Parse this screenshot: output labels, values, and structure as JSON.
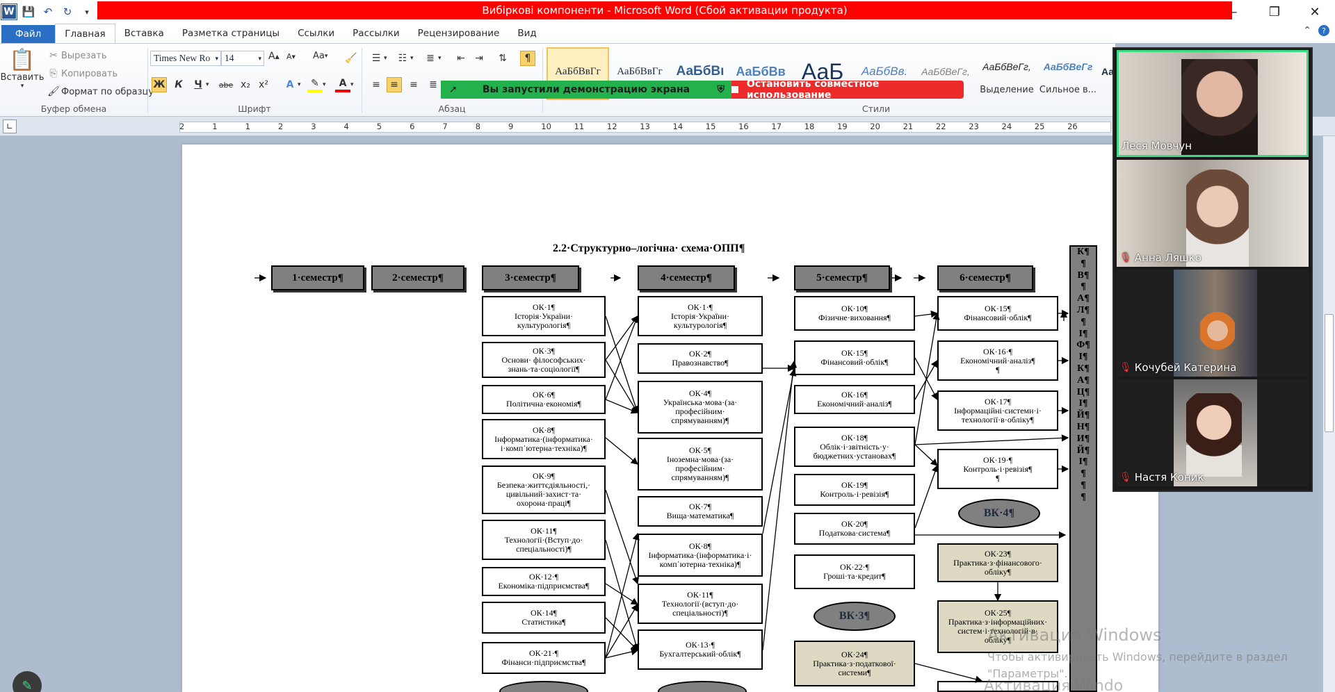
{
  "window": {
    "title": "Вибіркові компоненти - Microsoft Word (Сбой активации продукта)",
    "controls": [
      "–",
      "❐",
      "✕"
    ]
  },
  "qat": {
    "logo": "W",
    "save": "💾",
    "undo": "↶",
    "redo": "↻",
    "customize": "▾"
  },
  "tabs": {
    "file": "Файл",
    "items": [
      "Главная",
      "Вставка",
      "Разметка страницы",
      "Ссылки",
      "Рассылки",
      "Рецензирование",
      "Вид"
    ]
  },
  "ribbon": {
    "clipboard": {
      "paste": "Вставить",
      "cut": "Вырезать",
      "copy": "Копировать",
      "format_painter": "Формат по образцу",
      "label": "Буфер обмена"
    },
    "font": {
      "name": "Times New Ro",
      "size": "14",
      "bold": "Ж",
      "italic": "К",
      "underline": "Ч",
      "strike": "abe",
      "sub": "x₂",
      "sup": "x²",
      "grow": "A",
      "shrink": "A",
      "case": "Aa",
      "label": "Шрифт"
    },
    "paragraph": {
      "label": "Абзац",
      "pilcrow": "¶"
    },
    "styles": {
      "label": "Стили",
      "items": [
        {
          "preview": "АаБбВвГг",
          "name": ""
        },
        {
          "preview": "АаБбВвГг",
          "name": ""
        },
        {
          "preview": "АаБбВı",
          "name": ""
        },
        {
          "preview": "АаБбВв",
          "name": ""
        },
        {
          "preview": "АаБ",
          "name": ""
        },
        {
          "preview": "АаБбВв.",
          "name": ""
        },
        {
          "preview": "АаБбВеГг,",
          "name": ""
        },
        {
          "preview": "АаБбВеГг,",
          "name": "Выделение"
        },
        {
          "preview": "АаБбВеГг",
          "name": "Сильное в..."
        },
        {
          "preview": "Аа",
          "name": ""
        }
      ]
    }
  },
  "share": {
    "started": "Вы запустили демонстрацию экрана",
    "stop": "Остановить совместное использование"
  },
  "ruler": {
    "labels": [
      "2",
      "1",
      "1",
      "2",
      "3",
      "4",
      "5",
      "6",
      "7",
      "8",
      "9",
      "10",
      "11",
      "12",
      "13",
      "14",
      "15",
      "16",
      "17",
      "18",
      "19",
      "20",
      "21",
      "22",
      "23",
      "24",
      "25",
      "26"
    ]
  },
  "doc": {
    "heading": "2.2·Структурно–логічна· схема·ОПП¶",
    "semesters": [
      "1·семестр¶",
      "2·семестр¶",
      "3·семестр¶",
      "4·семестр¶",
      "5·семестр¶",
      "6·семестр¶"
    ],
    "col3": [
      [
        "ОК·1¶",
        "Історія·України·",
        "культурологія¶"
      ],
      [
        "ОК·3¶",
        "Основи· філософських·",
        "знань·та·соціології¶"
      ],
      [
        "ОК·6¶",
        "Політична·економія¶"
      ],
      [
        "ОК·8¶",
        "Інформатика·(інформатика·",
        "і·комп᾿ютерна·техніка)¶"
      ],
      [
        "ОК·9¶",
        "Безпека·життєдіяльності,·",
        "цивільний·захист·та·",
        "охорона·праці¶"
      ],
      [
        "ОК·11¶",
        "Технології·(Вступ·до·",
        "спеціальності)¶"
      ],
      [
        "ОК·12·¶",
        "Економіка·підприємства¶"
      ],
      [
        "ОК·14¶",
        "Статистика¶"
      ],
      [
        "ОК·21·¶",
        "Фінанси·підприємства¶"
      ]
    ],
    "col4": [
      [
        "ОК·1·¶",
        "Історія·України·",
        "культурологія¶"
      ],
      [
        "ОК·2¶",
        "Правознавство¶"
      ],
      [
        "ОК·4¶",
        "Українська·мова·(за·",
        "професійним·",
        "спрямуванням)¶"
      ],
      [
        "ОК·5¶",
        "Іноземна·мова·(за·",
        "професійним·",
        "спрямуванням)¶"
      ],
      [
        "ОК·7¶",
        "Вища·математика¶"
      ],
      [
        "ОК·8¶",
        "Інформатика·(інформатика·і·",
        "комп᾿ютерна·техніка)¶"
      ],
      [
        "ОК·11¶",
        "Технології·(вступ·до·",
        "спеціальності)¶"
      ],
      [
        "ОК·13·¶",
        "Бухгалтерський·облік¶"
      ]
    ],
    "col5": [
      [
        "ОК·10¶",
        "Фізичне·виховання¶"
      ],
      [
        "ОК·15¶",
        "Фінансовий·облік¶"
      ],
      [
        "ОК·16¶",
        "Економічний·аналіз¶"
      ],
      [
        "ОК·18¶",
        "Облік·і·звітність·у·",
        "бюджетних·установах¶"
      ],
      [
        "ОК·19¶",
        "Контроль·і·ревізія¶"
      ],
      [
        "ОК·20¶",
        "Податкова·система¶"
      ],
      [
        "ОК·22·¶",
        "Гроші·та·кредит¶"
      ]
    ],
    "col5_oval": "ВК·3¶",
    "col5_practice": [
      "ОК·24¶",
      "Практика·з·податкової·",
      "системи¶"
    ],
    "col6": [
      [
        "ОК·15¶",
        "Фінансовий·облік¶"
      ],
      [
        "ОК·16·¶",
        "Економічний·аналіз¶",
        "¶"
      ],
      [
        "ОК·17¶",
        "Інформаційні·системи·і·",
        "технології·в·обліку¶"
      ],
      [
        "ОК·19·¶",
        "Контроль·і·ревізія¶",
        "¶"
      ]
    ],
    "col6_oval": "ВК·4¶",
    "col6_practice": [
      [
        "ОК·23¶",
        "Практика·з·фінансового·",
        "обліку¶"
      ],
      [
        "ОК·25¶",
        "Практика·з·інформаційних·",
        "систем·і·технологій·в·",
        "обліку¶"
      ]
    ],
    "vertical_text": [
      "К¶",
      "¶",
      "В¶",
      "¶",
      "А¶",
      "Л¶",
      "¶",
      "І¶",
      "Ф¶",
      "І¶",
      "К¶",
      "А¶",
      "Ц¶",
      "І¶",
      "Й¶",
      "Н¶",
      "И¶",
      "Й¶",
      "І¶",
      "¶",
      "¶",
      "¶"
    ]
  },
  "participants": [
    {
      "name": "Леся Мовчун",
      "muted": false,
      "active": true
    },
    {
      "name": "Анна Ляшко",
      "muted": true,
      "active": false
    },
    {
      "name": "Кочубей Катерина",
      "muted": true,
      "active": false
    },
    {
      "name": "Настя Коник",
      "muted": true,
      "active": false
    }
  ],
  "watermark": {
    "line1": "Активация Windows",
    "line2": "Чтобы активировать Windows, перейдите в раздел",
    "line3": "\"Параметры\".",
    "line4": "Активация Windo"
  }
}
